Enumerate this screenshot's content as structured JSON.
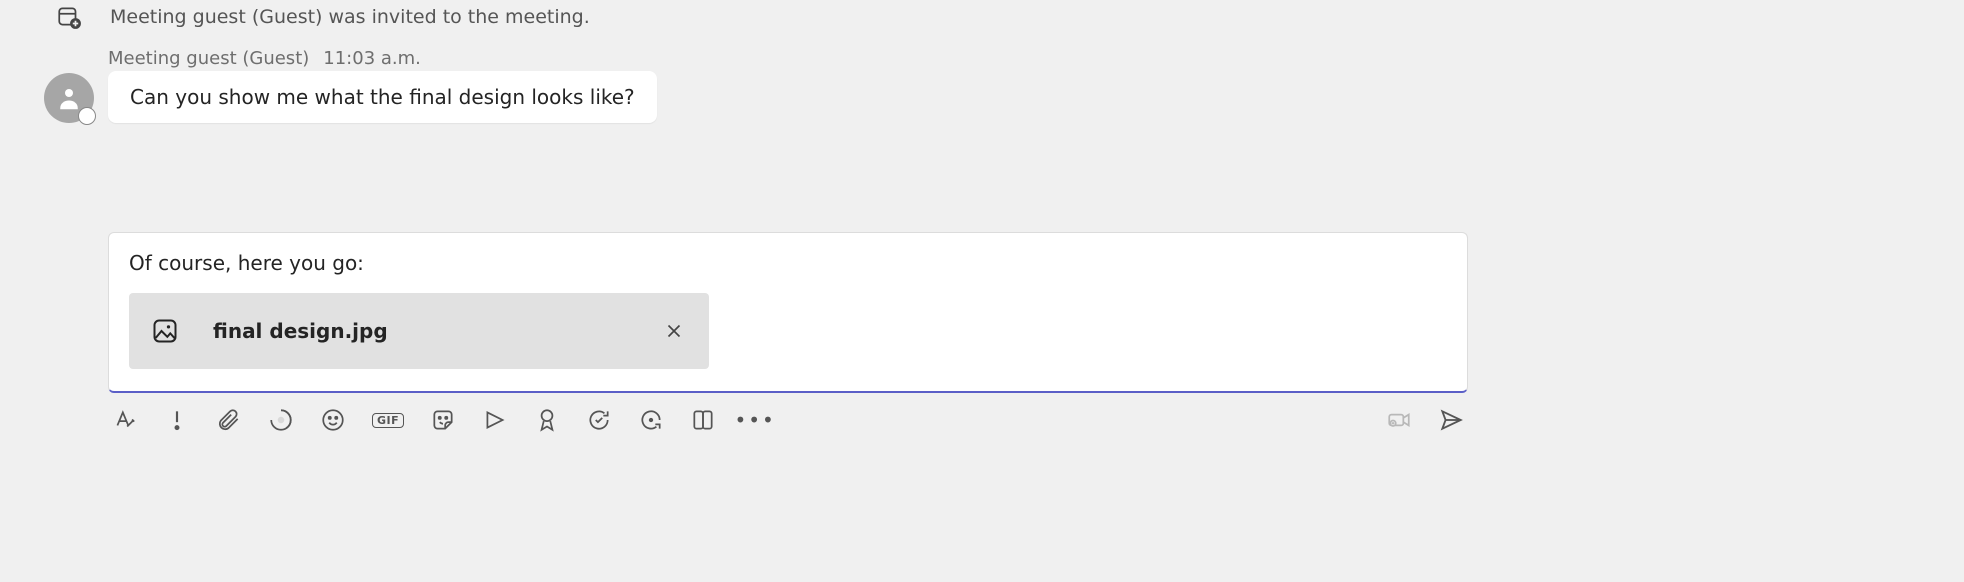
{
  "system_event": {
    "text": "Meeting guest (Guest) was invited to the meeting."
  },
  "message": {
    "sender": "Meeting guest (Guest)",
    "time": "11:03 a.m.",
    "text": "Can you show me what the final design looks like?"
  },
  "compose": {
    "text": "Of course, here you go:",
    "attachment_name": "final design.jpg"
  },
  "toolbar": {
    "format": "Format",
    "important": "Set delivery options",
    "attach": "Attach files",
    "loop": "Loop components",
    "emoji": "Emoji",
    "gif_label": "GIF",
    "sticker": "Sticker",
    "stream": "Stream",
    "praise": "Praise",
    "approvals": "Approvals",
    "updates": "Viva",
    "more_apps": "More apps",
    "more": "More options",
    "video_clip": "Video clip",
    "send": "Send"
  }
}
